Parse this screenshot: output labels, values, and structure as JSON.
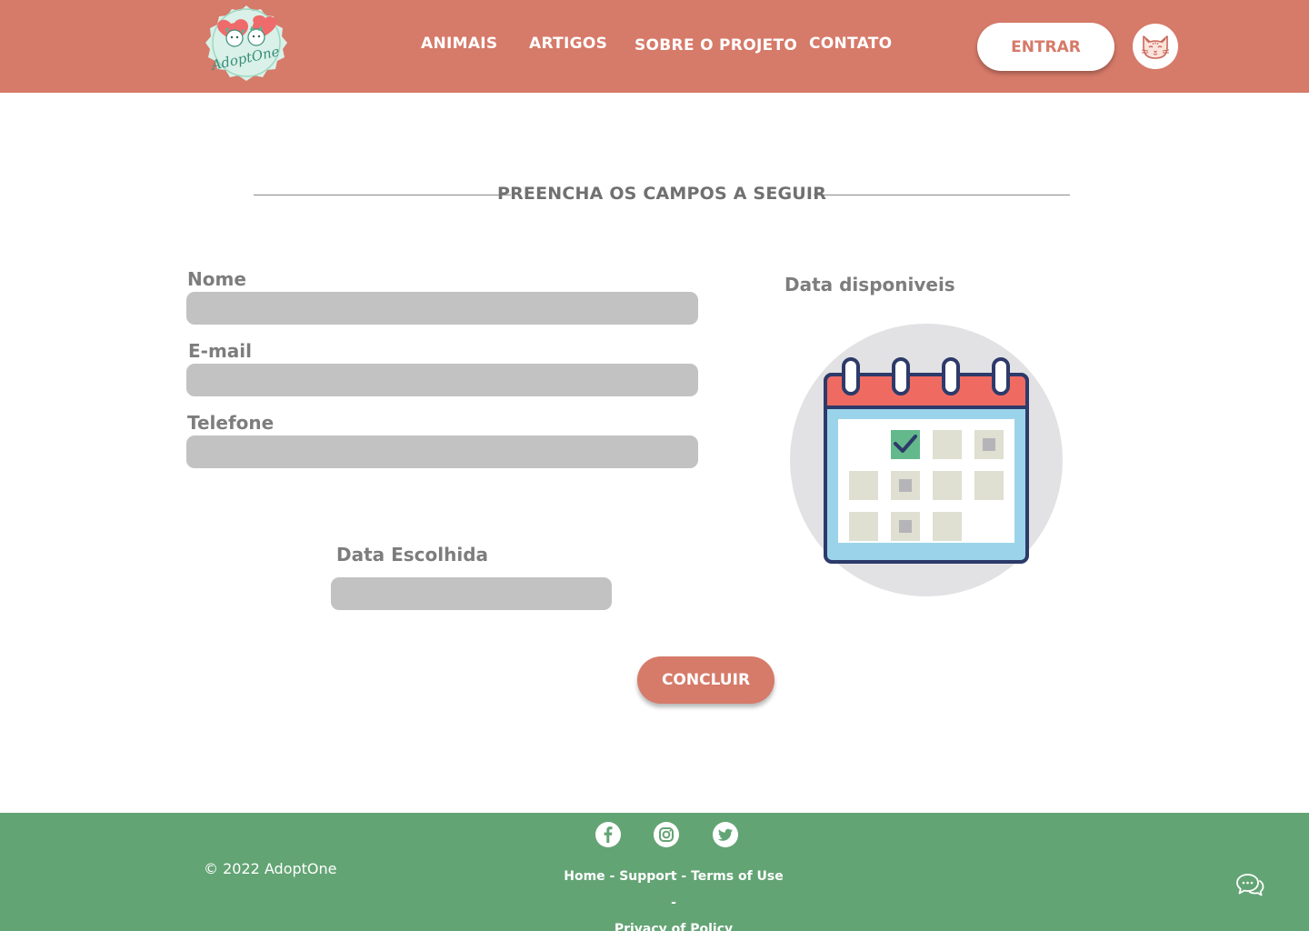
{
  "brand": {
    "logo_text": "AdoptOne"
  },
  "header": {
    "nav": [
      {
        "label": "ANIMAIS"
      },
      {
        "label": "ARTIGOS"
      },
      {
        "label": "SOBRE O PROJETO"
      },
      {
        "label": "CONTATO"
      }
    ],
    "login_label": "ENTRAR",
    "avatar_icon": "cat-icon"
  },
  "main": {
    "heading": "PREENCHA OS CAMPOS A SEGUIR",
    "fields": {
      "name": {
        "label": "Nome",
        "value": ""
      },
      "email": {
        "label": "E-mail",
        "value": ""
      },
      "phone": {
        "label": "Telefone",
        "value": ""
      },
      "chosen_date": {
        "label": "Data Escolhida",
        "value": ""
      }
    },
    "available_dates_label": "Data disponiveis",
    "calendar_icon": "calendar-icon",
    "submit_label": "CONCLUIR"
  },
  "footer": {
    "copyright": "© 2022 AdoptOne",
    "social": [
      "facebook-icon",
      "instagram-icon",
      "twitter-icon"
    ],
    "links": [
      "Home",
      "Support",
      "Terms of Use",
      "Privacy of Policy"
    ],
    "separator": " - ",
    "chat_icon": "chat-icon"
  },
  "colors": {
    "header": "#d67a69",
    "footer": "#63a474",
    "input": "#c2c2c2",
    "label": "#7d7d7d",
    "calendar_red": "#ef6b62",
    "calendar_blue": "#9bd4ea",
    "calendar_green": "#63b98b"
  }
}
